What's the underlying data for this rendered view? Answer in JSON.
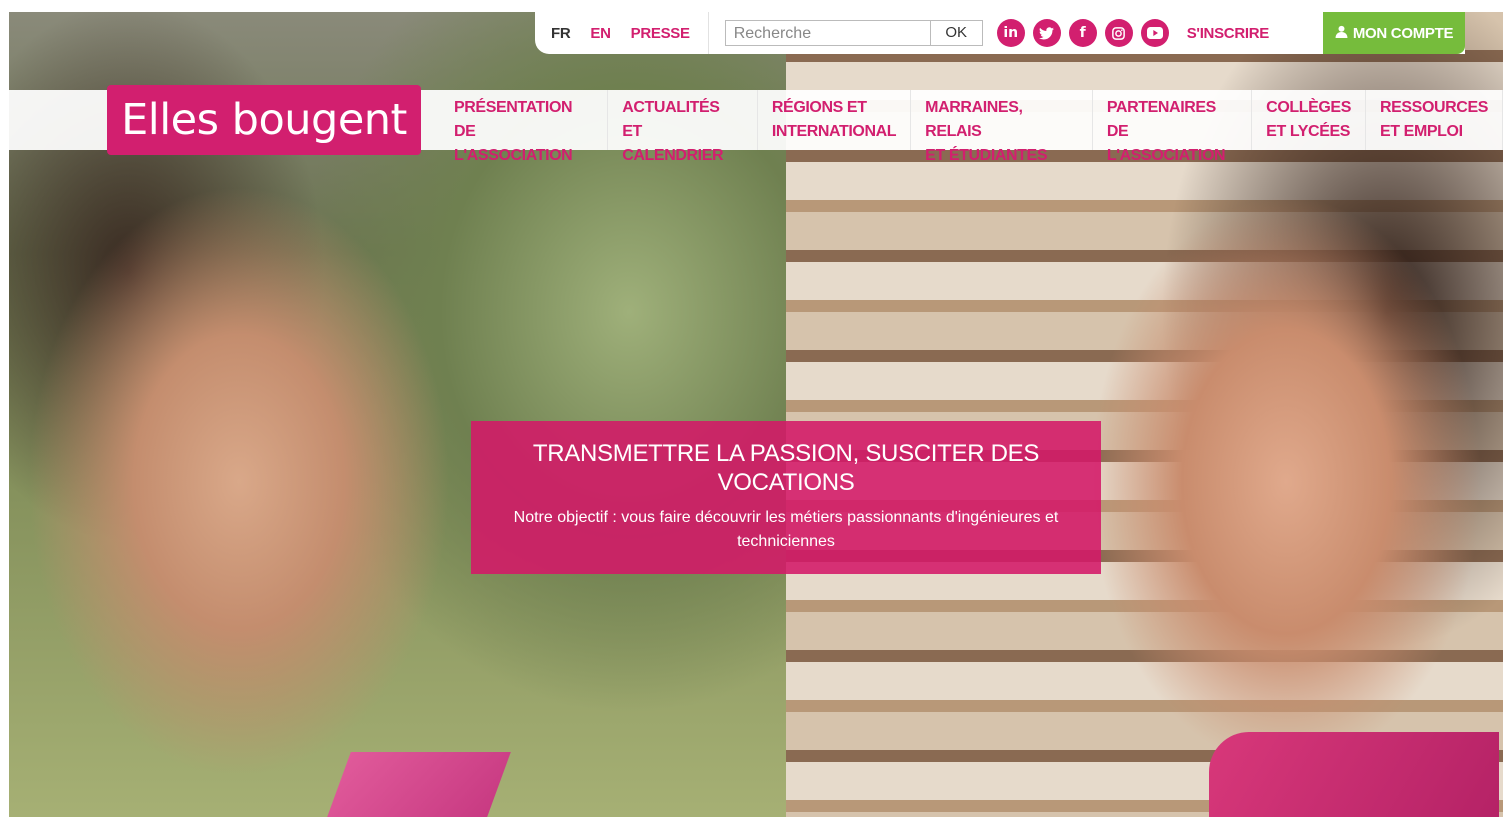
{
  "topbar": {
    "lang_fr": "FR",
    "lang_en": "EN",
    "press": "PRESSE",
    "search_placeholder": "Recherche",
    "search_button": "OK",
    "socials": [
      {
        "icon": "linkedin-icon",
        "glyph": "in"
      },
      {
        "icon": "twitter-icon",
        "glyph": "🐦"
      },
      {
        "icon": "facebook-icon",
        "glyph": "f"
      },
      {
        "icon": "instagram-icon",
        "glyph": "◎"
      },
      {
        "icon": "youtube-icon",
        "glyph": "▶"
      }
    ],
    "signup": "S'INSCRIRE",
    "account": "MON COMPTE",
    "account_icon": "person-icon"
  },
  "logo": {
    "text": "Elles bougent"
  },
  "nav": {
    "items": [
      "PRÉSENTATION\nDE L'ASSOCIATION",
      "ACTUALITÉS\nET CALENDRIER",
      "RÉGIONS ET\nINTERNATIONAL",
      "MARRAINES, RELAIS\nET ÉTUDIANTES",
      "PARTENAIRES DE\nL'ASSOCIATION",
      "COLLÈGES\nET LYCÉES",
      "RESSOURCES\nET EMPLOI"
    ]
  },
  "banner": {
    "title": "TRANSMETTRE LA PASSION, SUSCITER DES VOCATIONS",
    "subtitle": "Notre objectif : vous faire découvrir les métiers passionnants d'ingénieures et techniciennes"
  },
  "colors": {
    "brand_pink": "#d21f6f",
    "account_green": "#76bc3c"
  }
}
